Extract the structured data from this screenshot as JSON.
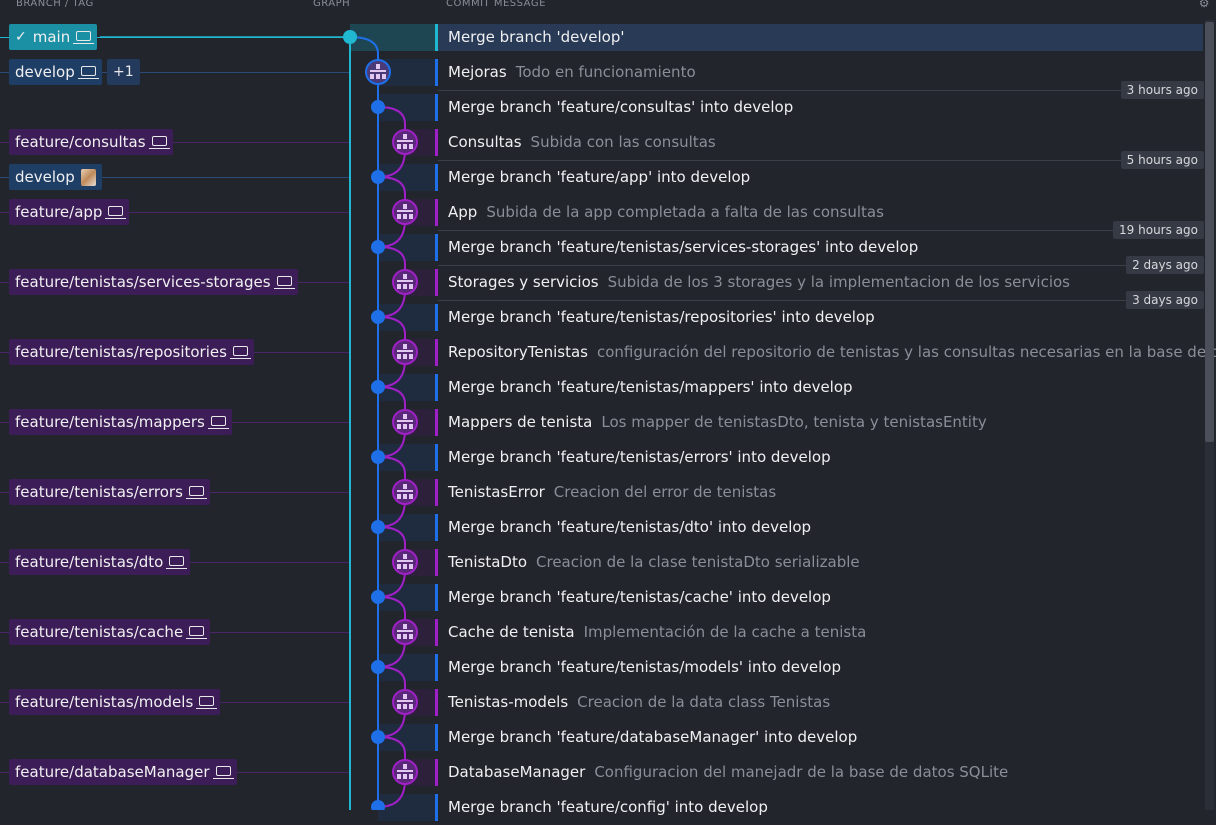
{
  "header": {
    "branch_tag": "BRANCH / TAG",
    "graph": "GRAPH",
    "commit_message": "COMMIT MESSAGE",
    "settings_icon": "gear-icon"
  },
  "colors": {
    "main": "#1b8fa3",
    "develop": "#1f3e66",
    "feature": "#3d1d57",
    "blue": "#1f6fe8",
    "purple": "#a020c8",
    "cyan": "#20b8d0"
  },
  "refs": [
    {
      "row": 0,
      "label": "main",
      "kind": "main",
      "checked": true,
      "icon": "laptop-icon"
    },
    {
      "row": 1,
      "label": "develop",
      "kind": "develop",
      "icon": "laptop-icon",
      "extra": "+1"
    },
    {
      "row": 3,
      "label": "feature/consultas",
      "kind": "feature",
      "icon": "laptop-icon"
    },
    {
      "row": 4,
      "label": "develop",
      "kind": "develop",
      "icon": "avatar-icon"
    },
    {
      "row": 5,
      "label": "feature/app",
      "kind": "feature",
      "icon": "laptop-icon"
    },
    {
      "row": 7,
      "label": "feature/tenistas/services-storages",
      "kind": "feature",
      "icon": "laptop-icon"
    },
    {
      "row": 9,
      "label": "feature/tenistas/repositories",
      "kind": "feature",
      "icon": "laptop-icon"
    },
    {
      "row": 11,
      "label": "feature/tenistas/mappers",
      "kind": "feature",
      "icon": "laptop-icon"
    },
    {
      "row": 13,
      "label": "feature/tenistas/errors",
      "kind": "feature",
      "icon": "laptop-icon"
    },
    {
      "row": 15,
      "label": "feature/tenistas/dto",
      "kind": "feature",
      "icon": "laptop-icon"
    },
    {
      "row": 17,
      "label": "feature/tenistas/cache",
      "kind": "feature",
      "icon": "laptop-icon"
    },
    {
      "row": 19,
      "label": "feature/tenistas/models",
      "kind": "feature",
      "icon": "laptop-icon"
    },
    {
      "row": 21,
      "label": "feature/databaseManager",
      "kind": "feature",
      "icon": "laptop-icon"
    }
  ],
  "commits": [
    {
      "summary": "Merge branch 'develop'",
      "desc": "",
      "kind": "main"
    },
    {
      "summary": "Mejoras",
      "desc": "Todo en funcionamiento",
      "kind": "develop",
      "time": "3 hours ago"
    },
    {
      "summary": "Merge branch 'feature/consultas' into develop",
      "desc": "",
      "kind": "develop"
    },
    {
      "summary": "Consultas",
      "desc": "Subida con las consultas",
      "kind": "feature",
      "time": "5 hours ago"
    },
    {
      "summary": "Merge branch 'feature/app' into develop",
      "desc": "",
      "kind": "develop"
    },
    {
      "summary": "App",
      "desc": "Subida de la app completada a falta de las consultas",
      "kind": "feature",
      "time": "19 hours ago"
    },
    {
      "summary": "Merge branch 'feature/tenistas/services-storages' into develop",
      "desc": "",
      "kind": "develop",
      "time": "2 days ago"
    },
    {
      "summary": "Storages y servicios",
      "desc": "Subida de los 3 storages y la implementacion de los servicios",
      "kind": "feature",
      "time": "3 days ago"
    },
    {
      "summary": "Merge branch 'feature/tenistas/repositories' into develop",
      "desc": "",
      "kind": "develop"
    },
    {
      "summary": "RepositoryTenistas",
      "desc": "configuración del repositorio de tenistas y las consultas necesarias en la base de datos",
      "kind": "feature"
    },
    {
      "summary": "Merge branch 'feature/tenistas/mappers' into develop",
      "desc": "",
      "kind": "develop"
    },
    {
      "summary": "Mappers de tenista",
      "desc": "Los mapper de tenistasDto, tenista y tenistasEntity",
      "kind": "feature"
    },
    {
      "summary": "Merge branch 'feature/tenistas/errors' into develop",
      "desc": "",
      "kind": "develop"
    },
    {
      "summary": "TenistasError",
      "desc": "Creacion del error de tenistas",
      "kind": "feature"
    },
    {
      "summary": "Merge branch 'feature/tenistas/dto' into develop",
      "desc": "",
      "kind": "develop"
    },
    {
      "summary": "TenistaDto",
      "desc": "Creacion de la clase tenistaDto serializable",
      "kind": "feature"
    },
    {
      "summary": "Merge branch 'feature/tenistas/cache' into develop",
      "desc": "",
      "kind": "develop"
    },
    {
      "summary": "Cache de tenista",
      "desc": "Implementación de la cache a tenista",
      "kind": "feature"
    },
    {
      "summary": "Merge branch 'feature/tenistas/models' into develop",
      "desc": "",
      "kind": "develop"
    },
    {
      "summary": "Tenistas-models",
      "desc": "Creacion de la data class Tenistas",
      "kind": "feature"
    },
    {
      "summary": "Merge branch 'feature/databaseManager' into develop",
      "desc": "",
      "kind": "develop"
    },
    {
      "summary": "DatabaseManager",
      "desc": "Configuracion del manejadr de la base de datos SQLite",
      "kind": "feature"
    },
    {
      "summary": "Merge branch 'feature/config' into develop",
      "desc": "",
      "kind": "develop"
    }
  ]
}
